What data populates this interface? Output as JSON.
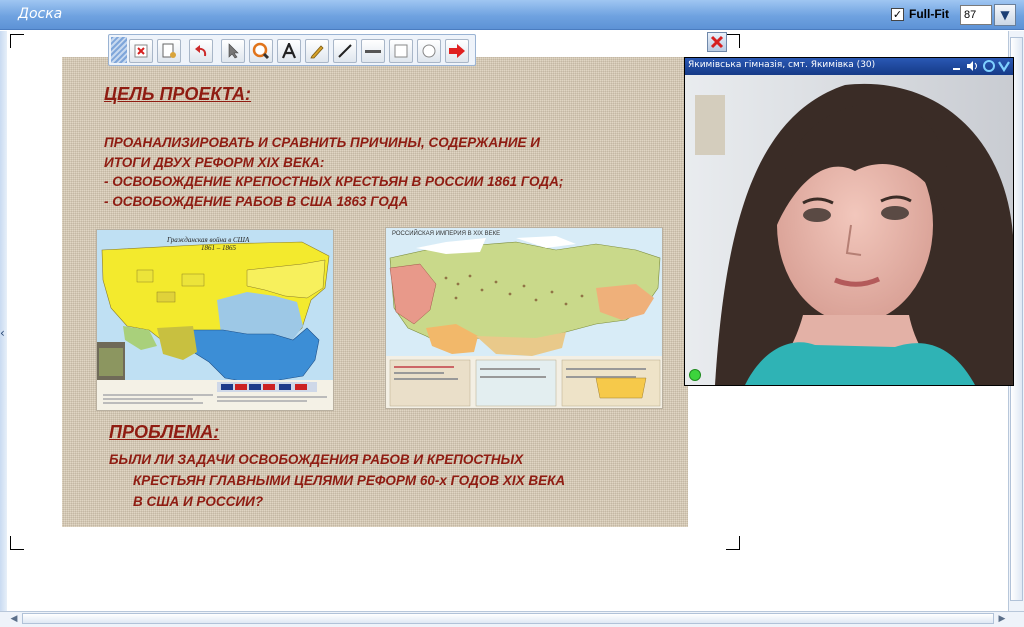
{
  "window": {
    "title": "Доска",
    "fullfit_checked": true,
    "fullfit_label": "Full-Fit",
    "zoom_value": "87"
  },
  "toolbar": {
    "tools": [
      {
        "name": "clear-icon",
        "color": "#d62020"
      },
      {
        "name": "new-page-icon",
        "color": "#d9a43b"
      },
      {
        "name": "undo-icon",
        "color": "#cc2a2a"
      },
      {
        "name": "pointer-icon",
        "color": "#666666"
      },
      {
        "name": "zoom-icon",
        "color": "#e0731a"
      },
      {
        "name": "text-icon",
        "color": "#222222"
      },
      {
        "name": "pencil-icon",
        "color": "#d6a12a"
      },
      {
        "name": "line-icon",
        "color": "#222222"
      },
      {
        "name": "thick-line-icon",
        "color": "#555555"
      },
      {
        "name": "rectangle-icon",
        "color": "#888888"
      },
      {
        "name": "circle-icon",
        "color": "#888888"
      },
      {
        "name": "arrow-icon",
        "color": "#e02020"
      }
    ]
  },
  "slide": {
    "goal_heading": "ЦЕЛЬ  ПРОЕКТА:",
    "goal_lines": [
      "ПРОАНАЛИЗИРОВАТЬ  И СРАВНИТЬ ПРИЧИНЫ, СОДЕРЖАНИЕ  И",
      "ИТОГИ  ДВУХ РЕФОРМ  XIX  ВЕКА:",
      "- ОСВОБОЖДЕНИЕ   КРЕПОСТНЫХ КРЕСТЬЯН В  РОССИИ 1861  ГОДА;",
      "- ОСВОБОЖДЕНИЕ  РАБОВ   В  США   1863  ГОДА"
    ],
    "usa_map_title": "Гражданская война в США",
    "usa_map_years": "1861 – 1865",
    "russia_map_title": "РОССИЙСКАЯ ИМПЕРИЯ В XIX ВЕКЕ",
    "problem_heading": "ПРОБЛЕМА:",
    "problem_lines": [
      "БЫЛИ  ЛИ  ЗАДАЧИ  ОСВОБОЖДЕНИЯ  РАБОВ  И  КРЕПОСТНЫХ",
      "КРЕСТЬЯН  ГЛАВНЫМИ  ЦЕЛЯМИ  РЕФОРМ  60-х  ГОДОВ XIX  ВЕКА",
      "В  США  И  РОССИИ?"
    ]
  },
  "video": {
    "title": "Якимівська гімназія, смт. Якимівка (30)",
    "status_color": "#3cd43c"
  },
  "colors": {
    "slide_text": "#8f1c12",
    "titlebar": "#6fa2e0"
  }
}
